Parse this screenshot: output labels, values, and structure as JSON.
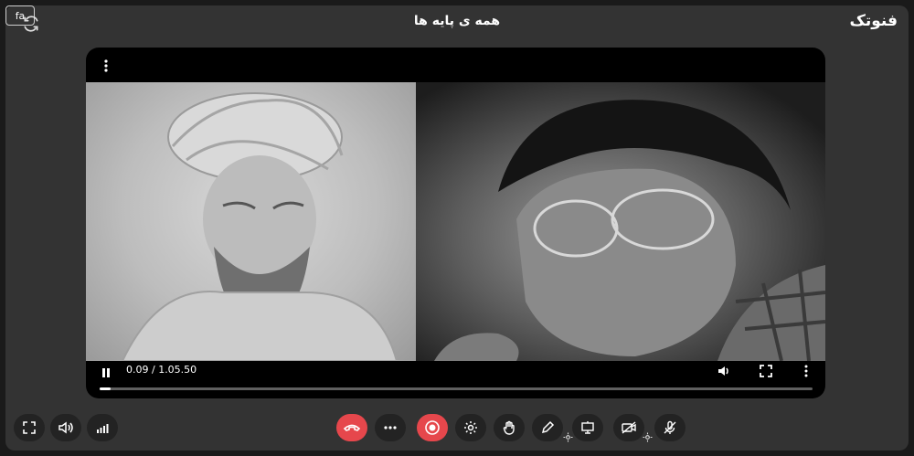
{
  "header": {
    "title": "همه ی پایه ها",
    "brand": "فنوتک",
    "lang": "fa"
  },
  "player": {
    "time": "0.09 / 1.05.50",
    "progress_percent": 1.5
  },
  "icons": {
    "refresh": "refresh-icon",
    "more_top": "kebab-icon",
    "pause": "pause-icon",
    "volume": "volume-icon",
    "fullscreen": "fullscreen-icon",
    "more": "kebab-icon"
  },
  "colors": {
    "background": "#333333",
    "player": "#000000",
    "button": "#232323",
    "danger": "#e6474c"
  }
}
